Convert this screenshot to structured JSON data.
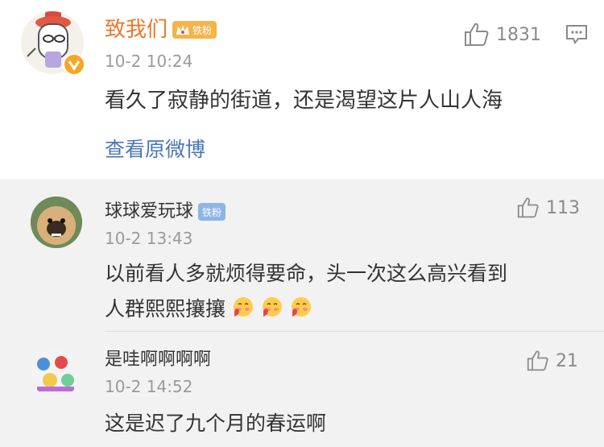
{
  "post": {
    "author": "致我们",
    "badge": "铁粉",
    "time": "10-2 10:24",
    "text": "看久了寂静的街道，还是渴望这片人山人海",
    "likes": "1831",
    "view_original": "查看原微博"
  },
  "replies": [
    {
      "author": "球球爱玩球",
      "badge": "铁粉",
      "time": "10-2 13:43",
      "text_line1": "以前看人多就烦得要命，头一次这么高兴看到",
      "text_line2": "人群熙熙攘攘",
      "emoji_count": 3,
      "likes": "113"
    },
    {
      "author": "是哇啊啊啊啊",
      "time": "10-2 14:52",
      "text": "这是迟了九个月的春运啊",
      "likes": "21"
    }
  ],
  "colors": {
    "author_orange": "#e8792c",
    "link_blue": "#4a77b5",
    "badge_gold": "#f3b54a",
    "badge_blue": "#8fb5e6"
  },
  "icons": [
    "thumbs-up-icon",
    "comment-icon",
    "verified-icon",
    "crown-icon",
    "blush-emoji"
  ]
}
